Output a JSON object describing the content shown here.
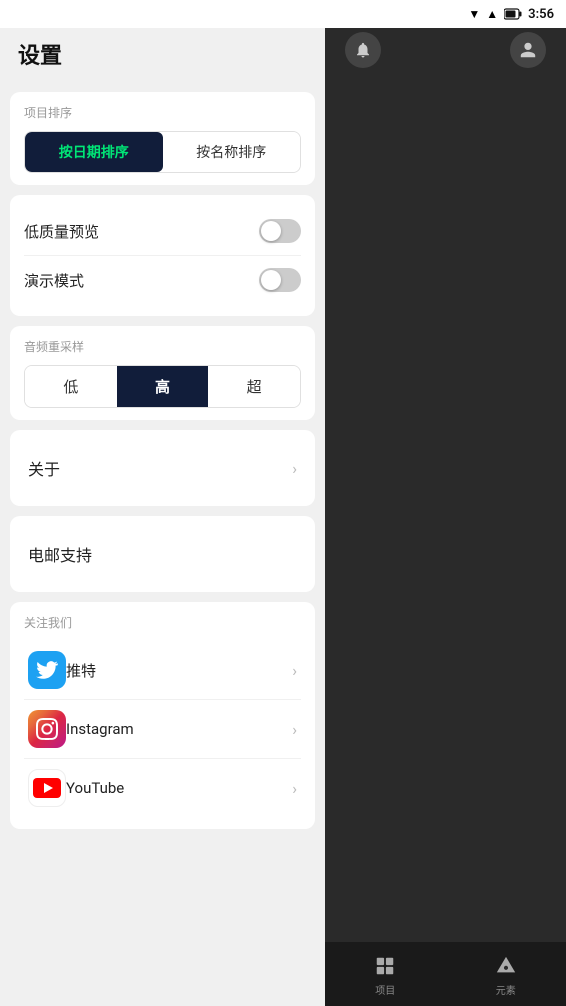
{
  "statusBar": {
    "time": "3:56",
    "icons": [
      "wifi",
      "signal",
      "battery"
    ]
  },
  "settings": {
    "title": "设置",
    "sortSection": {
      "label": "项目排序",
      "buttons": [
        {
          "id": "by-date",
          "label": "按日期排序",
          "active": true
        },
        {
          "id": "by-name",
          "label": "按名称排序",
          "active": false
        }
      ]
    },
    "toggleSection": {
      "items": [
        {
          "id": "low-quality",
          "label": "低质量预览",
          "enabled": false
        },
        {
          "id": "demo-mode",
          "label": "演示模式",
          "enabled": false
        }
      ]
    },
    "audioSection": {
      "label": "音频重采样",
      "buttons": [
        {
          "id": "low",
          "label": "低",
          "active": false
        },
        {
          "id": "high",
          "label": "高",
          "active": true
        },
        {
          "id": "ultra",
          "label": "超",
          "active": false
        }
      ]
    },
    "aboutSection": {
      "label": "关于",
      "hasChevron": true
    },
    "emailSection": {
      "label": "电邮支持",
      "hasChevron": false
    },
    "followSection": {
      "label": "关注我们",
      "items": [
        {
          "id": "twitter",
          "name": "推特",
          "platform": "twitter"
        },
        {
          "id": "instagram",
          "name": "Instagram",
          "platform": "instagram"
        },
        {
          "id": "youtube",
          "name": "YouTube",
          "platform": "youtube"
        }
      ]
    }
  },
  "bottomNav": {
    "items": [
      {
        "id": "projects",
        "label": "项目",
        "icon": "grid"
      },
      {
        "id": "elements",
        "label": "元素",
        "icon": "triangle"
      }
    ]
  }
}
